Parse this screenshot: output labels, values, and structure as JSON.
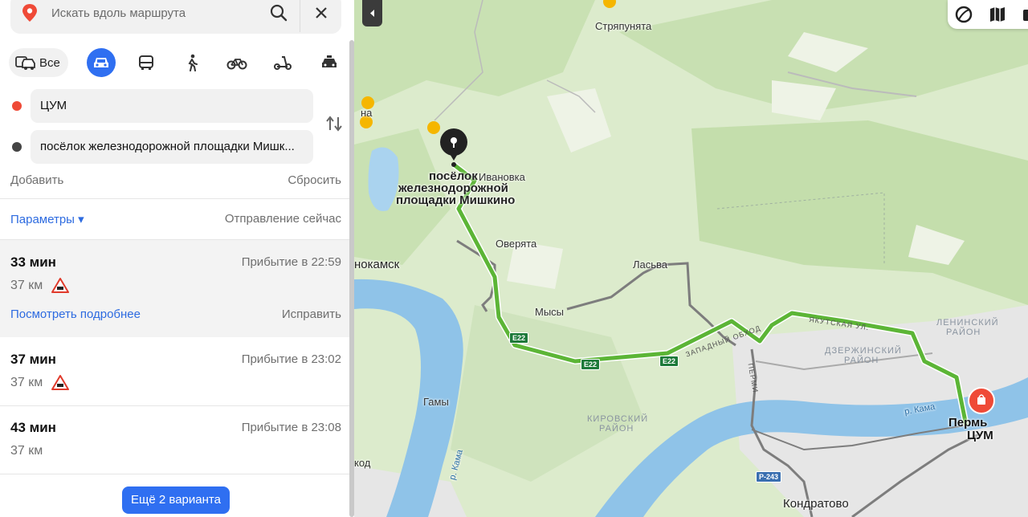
{
  "search": {
    "placeholder": "Искать вдоль маршрута"
  },
  "modes": {
    "all_label": "Все",
    "items": [
      "car",
      "bus",
      "walk",
      "bike",
      "scooter",
      "taxi"
    ],
    "active": "car"
  },
  "waypoints": {
    "from": "ЦУМ",
    "to": "посёлок железнодорожной площадки Мишк...",
    "add": "Добавить",
    "reset": "Сбросить"
  },
  "options": {
    "params": "Параметры ▾",
    "departure": "Отправление сейчас"
  },
  "routes": [
    {
      "time": "33 мин",
      "arrival": "Прибытие в 22:59",
      "distance": "37 км",
      "warning": true,
      "details": "Посмотреть подробнее",
      "fix": "Исправить"
    },
    {
      "time": "37 мин",
      "arrival": "Прибытие в 23:02",
      "distance": "37 км",
      "warning": true
    },
    {
      "time": "43 мин",
      "arrival": "Прибытие в 23:08",
      "distance": "37 км",
      "warning": false
    }
  ],
  "more_button": "Ещё 2 варианта",
  "map": {
    "labels": {
      "strjapunyata": "Стряпунята",
      "ivanovka": "Ивановка",
      "dest_line1": "посёлок",
      "dest_line2": "железнодорожной",
      "dest_line3": "площадки Мишкино",
      "overyata": "Оверята",
      "krasnokamsk": "нокамск",
      "lasva": "Ласьва",
      "mysy": "Мысы",
      "gamy": "Гамы",
      "kirovsky1": "КИРОВСКИЙ",
      "kirovsky2": "РАЙОН",
      "dzerzh1": "ДЗЕРЖИНСКИЙ",
      "dzerzh2": "РАЙОН",
      "lenin1": "ЛЕНИНСКИЙ",
      "lenin2": "РАЙОН",
      "perm": "Пермь",
      "tsum": "ЦУМ",
      "kondratovo": "Кондратово",
      "kama1": "р. Кама",
      "kama2": "р. Кама",
      "kod": "код",
      "na": "на",
      "yakutskaya": "ЯКУТСКАЯ УЛ.",
      "zap_obhod": "ЗАПАДНЫЙ ОБХОД",
      "permi": "ПЕРМИ",
      "e22a": "E22",
      "e22b": "E22",
      "e22c": "E22",
      "r243": "Р-243"
    },
    "colors": {
      "route": "#5cb536",
      "alt_route": "#7d7d7d",
      "river": "#8fc3e8",
      "forest": "#c6dfb0",
      "accent": "#2f6ff1"
    }
  }
}
